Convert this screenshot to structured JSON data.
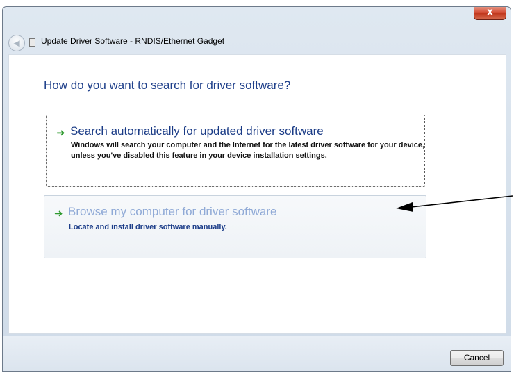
{
  "window": {
    "title": "Update Driver Software - RNDIS/Ethernet Gadget",
    "close_label": "x"
  },
  "content": {
    "heading": "How do you want to search for driver software?",
    "options": [
      {
        "title": "Search automatically for updated driver software",
        "description": "Windows will search your computer and the Internet for the latest driver software for your device, unless you've disabled this feature in your device installation settings."
      },
      {
        "title": "Browse my computer for driver software",
        "description": "Locate and install driver software manually."
      }
    ]
  },
  "footer": {
    "cancel_label": "Cancel"
  },
  "icons": {
    "back": "back-arrow-icon",
    "option_arrow": "green-arrow-icon",
    "annotation": "pointer-arrow"
  },
  "colors": {
    "heading": "#1e3f8a",
    "option_arrow": "#2f9a2f",
    "close_button": "#c0361c"
  }
}
